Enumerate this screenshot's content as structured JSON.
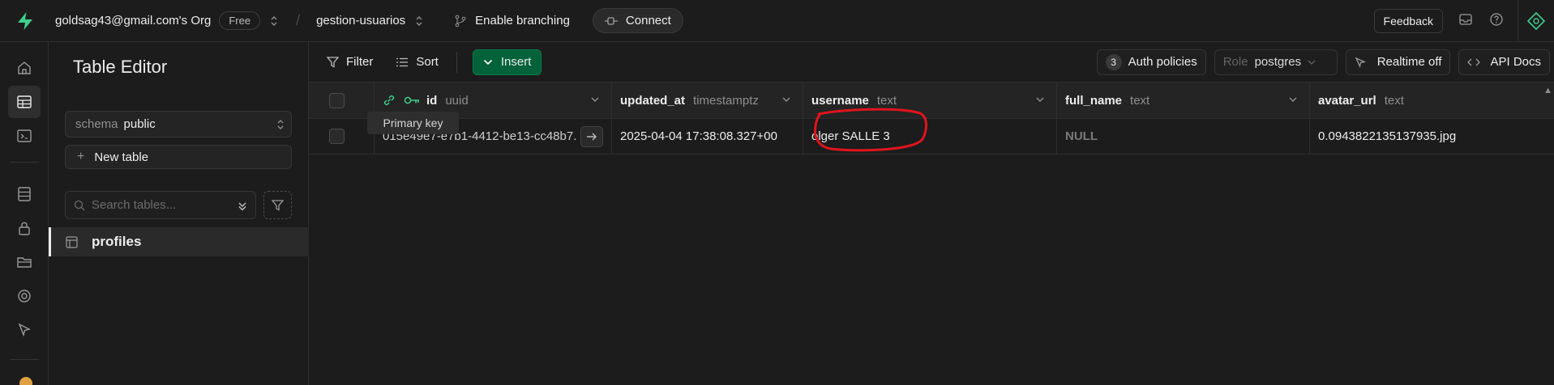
{
  "topbar": {
    "org": "goldsag43@gmail.com's Org",
    "plan": "Free",
    "project": "gestion-usuarios",
    "branching": "Enable branching",
    "connect": "Connect",
    "feedback": "Feedback"
  },
  "sidebar": {
    "title": "Table Editor",
    "schema_label": "schema",
    "schema_value": "public",
    "new_table": "New table",
    "search_placeholder": "Search tables...",
    "tables": [
      "profiles"
    ]
  },
  "toolbar": {
    "filter": "Filter",
    "sort": "Sort",
    "insert": "Insert",
    "auth_count": "3",
    "auth_policies": "Auth policies",
    "role_label": "Role",
    "role_value": "postgres",
    "realtime": "Realtime off",
    "api_docs": "API Docs"
  },
  "grid": {
    "columns": [
      {
        "name": "id",
        "type": "uuid"
      },
      {
        "name": "updated_at",
        "type": "timestamptz"
      },
      {
        "name": "username",
        "type": "text"
      },
      {
        "name": "full_name",
        "type": "text"
      },
      {
        "name": "avatar_url",
        "type": "text"
      }
    ],
    "rows": [
      {
        "id": "015e49e7-e7b1-4412-be13-cc48b7...",
        "updated_at": "2025-04-04 17:38:08.327+00",
        "username": "olger SALLE 3",
        "full_name": "NULL",
        "avatar_url": "0.0943822135137935.jpg"
      }
    ],
    "tooltip": "Primary key"
  },
  "colors": {
    "accent_green": "#3ecf8e",
    "insert_bg": "#006239",
    "annotation_red": "#e0141e"
  }
}
